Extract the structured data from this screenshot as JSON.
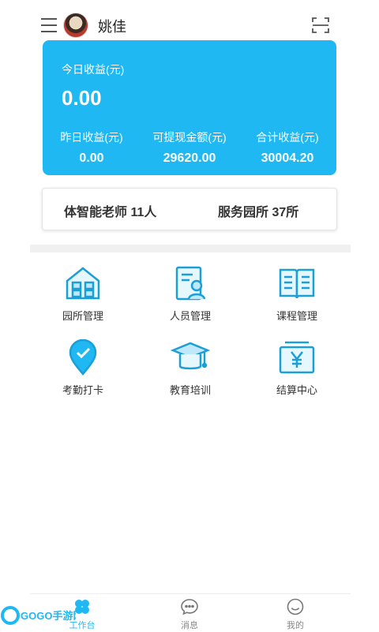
{
  "header": {
    "username": "姚佳"
  },
  "earnings": {
    "today_label": "今日收益(元)",
    "today_value": "0.00",
    "stats": [
      {
        "label": "昨日收益(元)",
        "value": "0.00"
      },
      {
        "label": "可提现金额(元)",
        "value": "29620.00"
      },
      {
        "label": "合计收益(元)",
        "value": "30004.20"
      }
    ]
  },
  "summary": {
    "teachers": "体智能老师 11人",
    "kindergartens": "服务园所 37所"
  },
  "grid": [
    {
      "label": "园所管理",
      "icon": "house-icon"
    },
    {
      "label": "人员管理",
      "icon": "person-document-icon"
    },
    {
      "label": "课程管理",
      "icon": "book-icon"
    },
    {
      "label": "考勤打卡",
      "icon": "location-check-icon"
    },
    {
      "label": "教育培训",
      "icon": "graduation-cap-icon"
    },
    {
      "label": "结算中心",
      "icon": "yen-box-icon"
    }
  ],
  "nav": [
    {
      "label": "工作台",
      "icon": "clover-icon"
    },
    {
      "label": "消息",
      "icon": "chat-icon"
    },
    {
      "label": "我的",
      "icon": "smile-icon"
    }
  ],
  "watermark": {
    "text": "GOGO手游网"
  },
  "colors": {
    "accent": "#1fb8f2",
    "card": "#1fb8f2",
    "icon_stroke": "#1a9fd6"
  }
}
